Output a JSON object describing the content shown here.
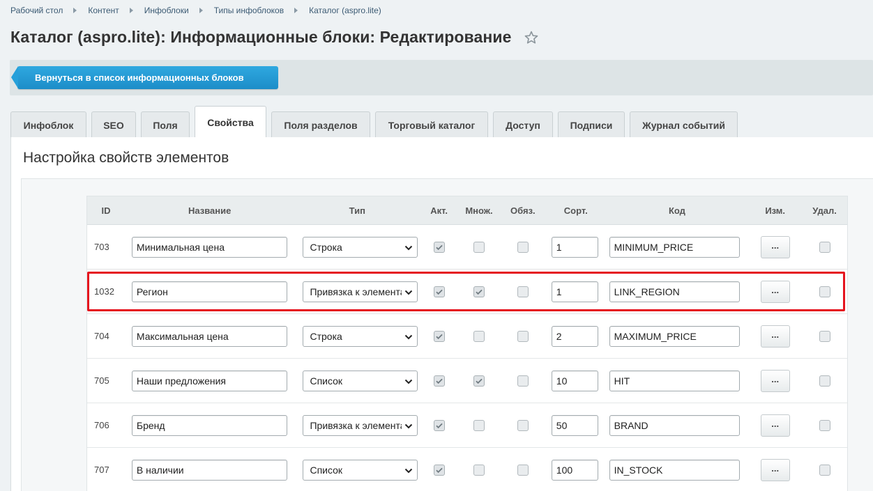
{
  "breadcrumbs": [
    "Рабочий стол",
    "Контент",
    "Инфоблоки",
    "Типы инфоблоков",
    "Каталог (aspro.lite)"
  ],
  "page_title": "Каталог (aspro.lite): Информационные блоки: Редактирование",
  "toolbar": {
    "back_label": "Вернуться в список информационных блоков"
  },
  "tabs": [
    {
      "label": "Инфоблок",
      "active": false
    },
    {
      "label": "SEO",
      "active": false
    },
    {
      "label": "Поля",
      "active": false
    },
    {
      "label": "Свойства",
      "active": true
    },
    {
      "label": "Поля разделов",
      "active": false
    },
    {
      "label": "Торговый каталог",
      "active": false
    },
    {
      "label": "Доступ",
      "active": false
    },
    {
      "label": "Подписи",
      "active": false
    },
    {
      "label": "Журнал событий",
      "active": false
    }
  ],
  "section_title": "Настройка свойств элементов",
  "table": {
    "headers": {
      "id": "ID",
      "name": "Название",
      "type": "Тип",
      "active": "Акт.",
      "multiple": "Множ.",
      "required": "Обяз.",
      "sort": "Сорт.",
      "code": "Код",
      "edit": "Изм.",
      "delete": "Удал."
    },
    "edit_label": "...",
    "rows": [
      {
        "id": "703",
        "name": "Минимальная цена",
        "type": "Строка",
        "active": true,
        "multiple": false,
        "required": false,
        "sort": "1",
        "code": "MINIMUM_PRICE",
        "delete": false
      },
      {
        "id": "1032",
        "name": "Регион",
        "type": "Привязка к элементам",
        "active": true,
        "multiple": true,
        "required": false,
        "sort": "1",
        "code": "LINK_REGION",
        "delete": false,
        "highlighted": true
      },
      {
        "id": "704",
        "name": "Максимальная цена",
        "type": "Строка",
        "active": true,
        "multiple": false,
        "required": false,
        "sort": "2",
        "code": "MAXIMUM_PRICE",
        "delete": false
      },
      {
        "id": "705",
        "name": "Наши предложения",
        "type": "Список",
        "active": true,
        "multiple": true,
        "required": false,
        "sort": "10",
        "code": "HIT",
        "delete": false
      },
      {
        "id": "706",
        "name": "Бренд",
        "type": "Привязка к элементам",
        "active": true,
        "multiple": false,
        "required": false,
        "sort": "50",
        "code": "BRAND",
        "delete": false
      },
      {
        "id": "707",
        "name": "В наличии",
        "type": "Список",
        "active": true,
        "multiple": false,
        "required": false,
        "sort": "100",
        "code": "IN_STOCK",
        "delete": false
      }
    ]
  },
  "colors": {
    "accent": "#1c8dc8",
    "highlight": "#e5131e"
  },
  "icons": {
    "favorite": "star-icon",
    "breadcrumb_separator": "triangle-right-icon",
    "select_arrow": "chevron-down-icon",
    "checkbox_checked": "check-icon"
  }
}
